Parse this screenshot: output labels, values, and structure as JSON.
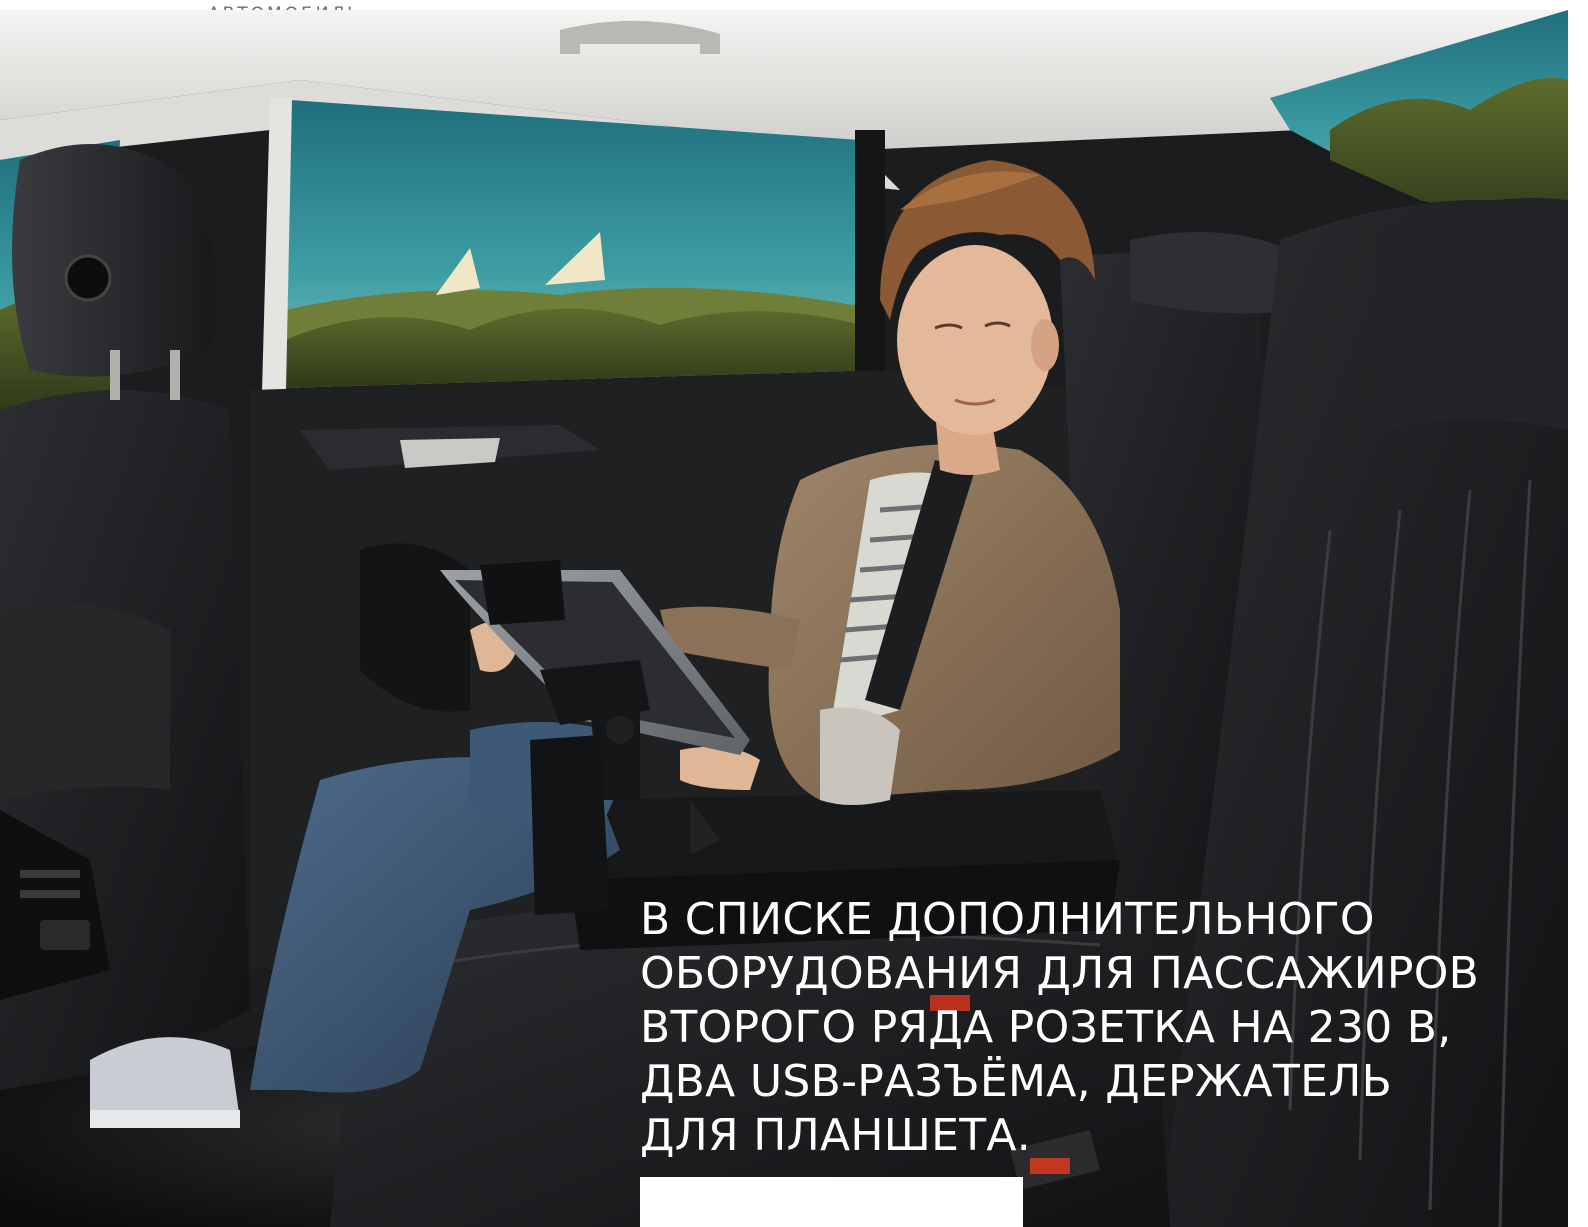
{
  "header": {
    "section_label": "АВТОМОБИЛЬ"
  },
  "photo": {
    "subject": "boy-using-tablet-in-car-rear-seat"
  },
  "caption": {
    "lines": [
      "В СПИСКЕ ДОПОЛНИТЕЛЬНОГО",
      "ОБОРУДОВАНИЯ ДЛЯ ПАССАЖИРОВ",
      "ВТОРОГО РЯДА РОЗЕТКА НА 230 В,",
      "ДВА USB-РАЗЪЁМА, ДЕРЖАТЕЛЬ",
      "ДЛЯ ПЛАНШЕТА."
    ]
  },
  "colors": {
    "caption_text": "#ffffff",
    "label_text": "#6d6d6d",
    "cabin_dark": "#1b1c1e",
    "sky": "#2f8c96"
  }
}
